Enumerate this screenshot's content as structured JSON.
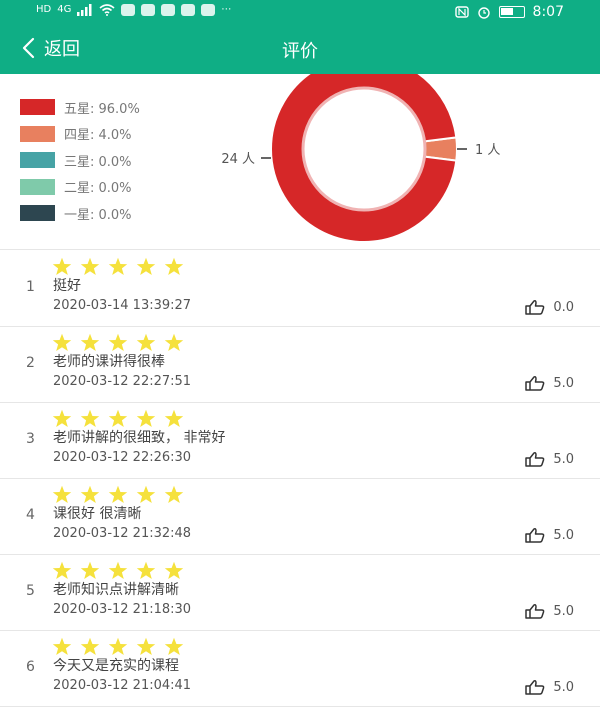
{
  "statusbar": {
    "left_items": [
      "HD",
      "4G",
      "⋯"
    ],
    "time": "8:07"
  },
  "header": {
    "back_label": "返回",
    "title": "评价"
  },
  "chart_data": {
    "type": "pie",
    "style": "donut",
    "legend": [
      {
        "label": "五星: 96.0%",
        "color": "#d62728"
      },
      {
        "label": "四星: 4.0%",
        "color": "#e8805f"
      },
      {
        "label": "三星: 0.0%",
        "color": "#46a3a5"
      },
      {
        "label": "二星: 0.0%",
        "color": "#7fcaaa"
      },
      {
        "label": "一星: 0.0%",
        "color": "#2d4650"
      }
    ],
    "slices": [
      {
        "name": "五星",
        "value": 24,
        "color": "#d62728",
        "label": "24 人"
      },
      {
        "name": "四星",
        "value": 1,
        "color": "#e8805f",
        "label": "1 人"
      }
    ],
    "legend_position": "left"
  },
  "reviews": [
    {
      "index": "1",
      "rating": 5,
      "comment": "挺好",
      "date": "2020-03-14 13:39:27",
      "likes": "0.0"
    },
    {
      "index": "2",
      "rating": 5,
      "comment": "老师的课讲得很棒",
      "date": "2020-03-12 22:27:51",
      "likes": "5.0"
    },
    {
      "index": "3",
      "rating": 5,
      "comment": "老师讲解的很细致， 非常好",
      "date": "2020-03-12 22:26:30",
      "likes": "5.0"
    },
    {
      "index": "4",
      "rating": 5,
      "comment": "课很好 很清晰",
      "date": "2020-03-12 21:32:48",
      "likes": "5.0"
    },
    {
      "index": "5",
      "rating": 5,
      "comment": "老师知识点讲解清晰",
      "date": "2020-03-12 21:18:30",
      "likes": "5.0"
    },
    {
      "index": "6",
      "rating": 5,
      "comment": "今天又是充实的课程",
      "date": "2020-03-12 21:04:41",
      "likes": "5.0"
    }
  ],
  "colors": {
    "header_bg": "#0fae85",
    "star": "#f5e13c"
  }
}
